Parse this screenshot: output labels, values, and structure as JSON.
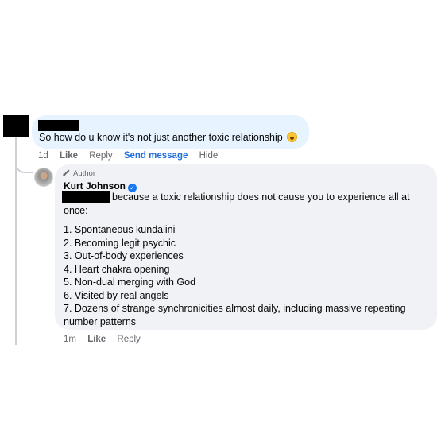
{
  "comment": {
    "text": "So how do u know it's not just another toxic relationship",
    "emoji": "laughing-emoji",
    "actions": {
      "time": "1d",
      "like": "Like",
      "reply": "Reply",
      "send_message": "Send message",
      "hide": "Hide"
    }
  },
  "reply": {
    "badge": "Author",
    "author": "Kurt Johnson",
    "verified_icon": "verified-badge-icon",
    "intro": "because a toxic relationship does not cause you to experience all at once:",
    "items": [
      "1. Spontaneous kundalini",
      "2. Becoming legit psychic",
      "3. Out-of-body experiences",
      "4. Heart chakra opening",
      "5. Non-dual merging with God",
      "6. Visited by real angels",
      "7. Dozens of strange synchronicities almost daily, including massive repeating number patterns"
    ],
    "actions": {
      "time": "1m",
      "like": "Like",
      "reply": "Reply"
    }
  },
  "colors": {
    "comment_bubble": "#e7f3ff",
    "reply_bubble": "#f0f2f5",
    "link": "#216fdb",
    "meta": "#65676b",
    "verified": "#1877f2"
  }
}
